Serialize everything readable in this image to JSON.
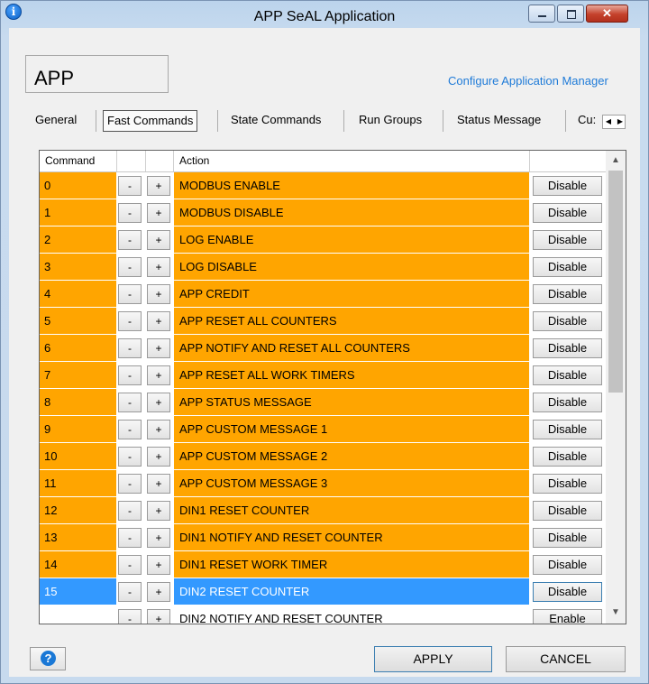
{
  "window": {
    "title": "APP SeAL Application",
    "info_icon": "i",
    "close_glyph": "✕"
  },
  "header": {
    "app_label": "APP",
    "configure_link": "Configure Application Manager"
  },
  "tabs": [
    "General",
    "Fast Commands",
    "State Commands",
    "Run Groups",
    "Status Message",
    "Cu:"
  ],
  "active_tab": "Fast Commands",
  "table": {
    "columns": [
      "Command",
      "",
      "",
      "Action",
      ""
    ],
    "minus_label": "-",
    "plus_label": "+",
    "rows": [
      {
        "command": "0",
        "action": "MODBUS ENABLE",
        "button": "Disable"
      },
      {
        "command": "1",
        "action": "MODBUS DISABLE",
        "button": "Disable"
      },
      {
        "command": "2",
        "action": "LOG ENABLE",
        "button": "Disable"
      },
      {
        "command": "3",
        "action": "LOG DISABLE",
        "button": "Disable"
      },
      {
        "command": "4",
        "action": "APP CREDIT",
        "button": "Disable"
      },
      {
        "command": "5",
        "action": "APP RESET ALL COUNTERS",
        "button": "Disable"
      },
      {
        "command": "6",
        "action": "APP NOTIFY AND RESET ALL COUNTERS",
        "button": "Disable"
      },
      {
        "command": "7",
        "action": "APP RESET ALL WORK TIMERS",
        "button": "Disable"
      },
      {
        "command": "8",
        "action": "APP STATUS MESSAGE",
        "button": "Disable"
      },
      {
        "command": "9",
        "action": "APP CUSTOM MESSAGE 1",
        "button": "Disable"
      },
      {
        "command": "10",
        "action": "APP CUSTOM MESSAGE 2",
        "button": "Disable"
      },
      {
        "command": "11",
        "action": "APP CUSTOM MESSAGE 3",
        "button": "Disable"
      },
      {
        "command": "12",
        "action": "DIN1 RESET COUNTER",
        "button": "Disable"
      },
      {
        "command": "13",
        "action": "DIN1 NOTIFY AND RESET COUNTER",
        "button": "Disable"
      },
      {
        "command": "14",
        "action": "DIN1 RESET WORK TIMER",
        "button": "Disable"
      },
      {
        "command": "15",
        "action": "DIN2 RESET COUNTER",
        "button": "Disable",
        "selected": true
      },
      {
        "command": "",
        "action": "DIN2 NOTIFY AND RESET COUNTER",
        "button": "Enable",
        "partial": true
      }
    ]
  },
  "footer": {
    "help_icon": "?",
    "apply_label": "APPLY",
    "cancel_label": "CANCEL"
  },
  "colors": {
    "row_active": "#ffa500",
    "row_selected": "#3399ff",
    "link": "#1f7bd8"
  }
}
